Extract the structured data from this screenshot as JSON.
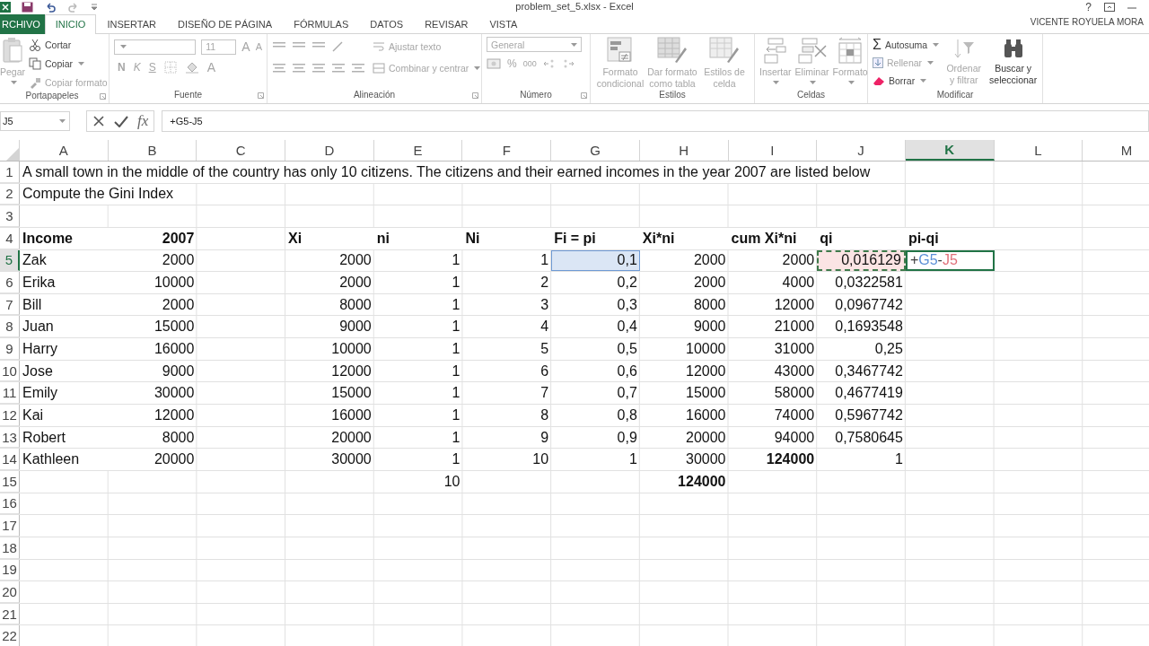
{
  "title_bar": {
    "title": "problem_set_5.xlsx - Excel",
    "help": "?",
    "user": "VICENTE ROYUELA MORA"
  },
  "tabs": [
    {
      "label": "RCHIVO",
      "kind": "file",
      "selected": false
    },
    {
      "label": "INICIO",
      "kind": "tab",
      "selected": true
    },
    {
      "label": "INSERTAR",
      "kind": "tab",
      "selected": false
    },
    {
      "label": "DISEÑO DE PÁGINA",
      "kind": "tab",
      "selected": false
    },
    {
      "label": "FÓRMULAS",
      "kind": "tab",
      "selected": false
    },
    {
      "label": "DATOS",
      "kind": "tab",
      "selected": false
    },
    {
      "label": "REVISAR",
      "kind": "tab",
      "selected": false
    },
    {
      "label": "VISTA",
      "kind": "tab",
      "selected": false
    }
  ],
  "ribbon": {
    "clipboard": {
      "label": "Portapapeles",
      "paste": {
        "label": "Pegar",
        "disabled": true
      },
      "cut": {
        "label": "Cortar",
        "disabled": false
      },
      "copy": {
        "label": "Copiar",
        "disabled": false
      },
      "format_painter": {
        "label": "Copiar formato",
        "disabled": true
      }
    },
    "font": {
      "label": "Fuente",
      "disabled": true,
      "size": "11",
      "grow": "A",
      "shrink": "A",
      "bold": "N",
      "italic": "K",
      "underline": "S",
      "font_color": "A"
    },
    "alignment": {
      "label": "Alineación",
      "disabled": true,
      "wrap_text": "Ajustar texto",
      "merge": "Combinar y centrar"
    },
    "number": {
      "label": "Número",
      "disabled": true,
      "format": "General",
      "percent": "%",
      "thousands": "000"
    },
    "styles": {
      "label": "Estilos",
      "disabled": true,
      "buttons": [
        "Formato condicional",
        "Dar formato como tabla",
        "Estilos de celda"
      ]
    },
    "cells": {
      "label": "Celdas",
      "disabled": true,
      "buttons": [
        "Insertar",
        "Eliminar",
        "Formato"
      ]
    },
    "editing": {
      "label": "Modificar",
      "autosum": {
        "symbol": "Σ",
        "label": "Autosuma",
        "disabled": false
      },
      "fill": {
        "label": "Rellenar",
        "disabled": true
      },
      "clear": {
        "label": "Borrar",
        "disabled": false
      },
      "sort": {
        "label": "Ordenar y filtrar",
        "disabled": true
      },
      "find": {
        "label": "Buscar y seleccionar",
        "disabled": false
      }
    }
  },
  "formula_bar": {
    "name_box": "J5",
    "function_button": "fx",
    "formula": "+G5-J5"
  },
  "sheet": {
    "columns": [
      {
        "label": "A",
        "selected": false
      },
      {
        "label": "B",
        "selected": false
      },
      {
        "label": "C",
        "selected": false
      },
      {
        "label": "D",
        "selected": false
      },
      {
        "label": "E",
        "selected": false
      },
      {
        "label": "F",
        "selected": false
      },
      {
        "label": "G",
        "selected": false
      },
      {
        "label": "H",
        "selected": false
      },
      {
        "label": "I",
        "selected": false
      },
      {
        "label": "J",
        "selected": false
      },
      {
        "label": "K",
        "selected": true
      },
      {
        "label": "L",
        "selected": false
      },
      {
        "label": "M",
        "selected": false
      }
    ],
    "rows": [
      {
        "label": "1",
        "selected": false,
        "cells": [
          {
            "text": "A small town in the middle of the country has only 10 citizens. The citizens and their earned incomes in the year 2007 are listed below",
            "kind": "text"
          }
        ]
      },
      {
        "label": "2",
        "selected": false,
        "cells": [
          {
            "text": "Compute the Gini Index",
            "kind": "text"
          }
        ]
      },
      {
        "label": "3",
        "selected": false
      },
      {
        "label": "4",
        "selected": false,
        "cells": [
          {
            "text": "Income",
            "kind": "text",
            "bold": true
          },
          {
            "text": "2007",
            "kind": "number",
            "bold": true
          },
          null,
          {
            "text": "Xi",
            "kind": "text",
            "bold": true
          },
          {
            "text": "ni",
            "kind": "text",
            "bold": true
          },
          {
            "text": "Ni",
            "kind": "text",
            "bold": true
          },
          {
            "text": "Fi = pi",
            "kind": "text",
            "bold": true
          },
          {
            "text": "Xi*ni",
            "kind": "text",
            "bold": true
          },
          {
            "text": "cum Xi*ni",
            "kind": "text",
            "bold": true
          },
          {
            "text": "qi",
            "kind": "text",
            "bold": true
          },
          {
            "text": "pi-qi",
            "kind": "text",
            "bold": true
          }
        ]
      },
      {
        "label": "5",
        "selected": true,
        "cells": [
          {
            "text": "Zak",
            "kind": "text"
          },
          {
            "text": "2000",
            "kind": "number"
          },
          null,
          {
            "text": "2000",
            "kind": "number"
          },
          {
            "text": "1",
            "kind": "number"
          },
          {
            "text": "1",
            "kind": "number"
          },
          {
            "text": "0,1",
            "kind": "number",
            "selected": true
          },
          {
            "text": "2000",
            "kind": "number"
          },
          {
            "text": "2000",
            "kind": "number"
          },
          {
            "text": "0,016129",
            "kind": "number",
            "copied": true
          },
          {
            "kind": "editing",
            "parts": [
              {
                "text": "+",
                "color": "#404040"
              },
              {
                "text": "G5",
                "color": "#5b8fd6"
              },
              {
                "text": "-",
                "color": "#404040"
              },
              {
                "text": "J5",
                "color": "#e0707a"
              }
            ]
          }
        ]
      },
      {
        "label": "6",
        "selected": false,
        "cells": [
          {
            "text": "Erika",
            "kind": "text"
          },
          {
            "text": "10000",
            "kind": "number"
          },
          null,
          {
            "text": "2000",
            "kind": "number"
          },
          {
            "text": "1",
            "kind": "number"
          },
          {
            "text": "2",
            "kind": "number"
          },
          {
            "text": "0,2",
            "kind": "number"
          },
          {
            "text": "2000",
            "kind": "number"
          },
          {
            "text": "4000",
            "kind": "number"
          },
          {
            "text": "0,0322581",
            "kind": "number"
          }
        ]
      },
      {
        "label": "7",
        "selected": false,
        "cells": [
          {
            "text": "Bill",
            "kind": "text"
          },
          {
            "text": "2000",
            "kind": "number"
          },
          null,
          {
            "text": "8000",
            "kind": "number"
          },
          {
            "text": "1",
            "kind": "number"
          },
          {
            "text": "3",
            "kind": "number"
          },
          {
            "text": "0,3",
            "kind": "number"
          },
          {
            "text": "8000",
            "kind": "number"
          },
          {
            "text": "12000",
            "kind": "number"
          },
          {
            "text": "0,0967742",
            "kind": "number"
          }
        ]
      },
      {
        "label": "8",
        "selected": false,
        "cells": [
          {
            "text": "Juan",
            "kind": "text"
          },
          {
            "text": "15000",
            "kind": "number"
          },
          null,
          {
            "text": "9000",
            "kind": "number"
          },
          {
            "text": "1",
            "kind": "number"
          },
          {
            "text": "4",
            "kind": "number"
          },
          {
            "text": "0,4",
            "kind": "number"
          },
          {
            "text": "9000",
            "kind": "number"
          },
          {
            "text": "21000",
            "kind": "number"
          },
          {
            "text": "0,1693548",
            "kind": "number"
          }
        ]
      },
      {
        "label": "9",
        "selected": false,
        "cells": [
          {
            "text": "Harry",
            "kind": "text"
          },
          {
            "text": "16000",
            "kind": "number"
          },
          null,
          {
            "text": "10000",
            "kind": "number"
          },
          {
            "text": "1",
            "kind": "number"
          },
          {
            "text": "5",
            "kind": "number"
          },
          {
            "text": "0,5",
            "kind": "number"
          },
          {
            "text": "10000",
            "kind": "number"
          },
          {
            "text": "31000",
            "kind": "number"
          },
          {
            "text": "0,25",
            "kind": "number"
          }
        ]
      },
      {
        "label": "10",
        "selected": false,
        "cells": [
          {
            "text": "Jose",
            "kind": "text"
          },
          {
            "text": "9000",
            "kind": "number"
          },
          null,
          {
            "text": "12000",
            "kind": "number"
          },
          {
            "text": "1",
            "kind": "number"
          },
          {
            "text": "6",
            "kind": "number"
          },
          {
            "text": "0,6",
            "kind": "number"
          },
          {
            "text": "12000",
            "kind": "number"
          },
          {
            "text": "43000",
            "kind": "number"
          },
          {
            "text": "0,3467742",
            "kind": "number"
          }
        ]
      },
      {
        "label": "11",
        "selected": false,
        "cells": [
          {
            "text": "Emily",
            "kind": "text"
          },
          {
            "text": "30000",
            "kind": "number"
          },
          null,
          {
            "text": "15000",
            "kind": "number"
          },
          {
            "text": "1",
            "kind": "number"
          },
          {
            "text": "7",
            "kind": "number"
          },
          {
            "text": "0,7",
            "kind": "number"
          },
          {
            "text": "15000",
            "kind": "number"
          },
          {
            "text": "58000",
            "kind": "number"
          },
          {
            "text": "0,4677419",
            "kind": "number"
          }
        ]
      },
      {
        "label": "12",
        "selected": false,
        "cells": [
          {
            "text": "Kai",
            "kind": "text"
          },
          {
            "text": "12000",
            "kind": "number"
          },
          null,
          {
            "text": "16000",
            "kind": "number"
          },
          {
            "text": "1",
            "kind": "number"
          },
          {
            "text": "8",
            "kind": "number"
          },
          {
            "text": "0,8",
            "kind": "number"
          },
          {
            "text": "16000",
            "kind": "number"
          },
          {
            "text": "74000",
            "kind": "number"
          },
          {
            "text": "0,5967742",
            "kind": "number"
          }
        ]
      },
      {
        "label": "13",
        "selected": false,
        "cells": [
          {
            "text": "Robert",
            "kind": "text"
          },
          {
            "text": "8000",
            "kind": "number"
          },
          null,
          {
            "text": "20000",
            "kind": "number"
          },
          {
            "text": "1",
            "kind": "number"
          },
          {
            "text": "9",
            "kind": "number"
          },
          {
            "text": "0,9",
            "kind": "number"
          },
          {
            "text": "20000",
            "kind": "number"
          },
          {
            "text": "94000",
            "kind": "number"
          },
          {
            "text": "0,7580645",
            "kind": "number"
          }
        ]
      },
      {
        "label": "14",
        "selected": false,
        "cells": [
          {
            "text": "Kathleen",
            "kind": "text"
          },
          {
            "text": "20000",
            "kind": "number"
          },
          null,
          {
            "text": "30000",
            "kind": "number"
          },
          {
            "text": "1",
            "kind": "number"
          },
          {
            "text": "10",
            "kind": "number"
          },
          {
            "text": "1",
            "kind": "number"
          },
          {
            "text": "30000",
            "kind": "number"
          },
          {
            "text": "124000",
            "kind": "number",
            "bold": true
          },
          {
            "text": "1",
            "kind": "number"
          }
        ]
      },
      {
        "label": "15",
        "selected": false,
        "cells": [
          null,
          null,
          null,
          null,
          {
            "text": "10",
            "kind": "number"
          },
          null,
          null,
          {
            "text": "124000",
            "kind": "number",
            "bold": true
          }
        ]
      },
      {
        "label": "16",
        "selected": false
      },
      {
        "label": "17",
        "selected": false
      },
      {
        "label": "18",
        "selected": false
      },
      {
        "label": "19",
        "selected": false
      },
      {
        "label": "20",
        "selected": false
      },
      {
        "label": "21",
        "selected": false
      },
      {
        "label": "22",
        "selected": false
      }
    ]
  }
}
